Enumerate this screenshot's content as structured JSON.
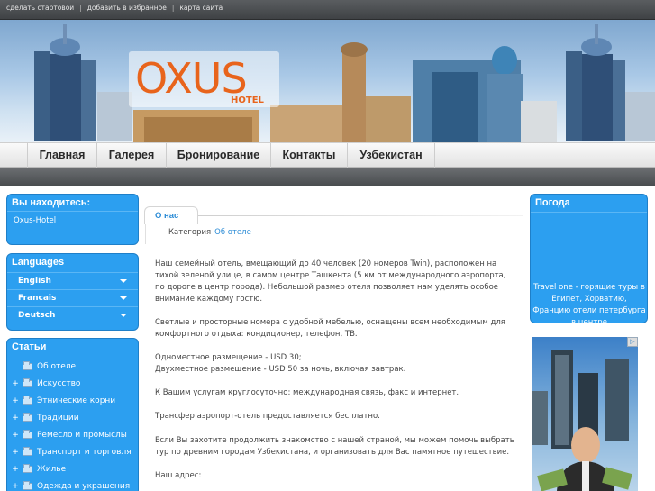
{
  "topbar": {
    "links": [
      "сделать стартовой",
      "добавить в избранное",
      "карта сайта"
    ],
    "separator": "|"
  },
  "logo": {
    "main": "OXUS",
    "sub": "HOTEL"
  },
  "nav": [
    "Главная",
    "Галерея",
    "Бронирование",
    "Контакты",
    "Узбекистан"
  ],
  "left": {
    "location_title": "Вы находитесь:",
    "location_value": "Oxus-Hotel",
    "languages_title": "Languages",
    "languages": [
      "English",
      "Francais",
      "Deutsch"
    ],
    "articles_title": "Статьи",
    "articles": [
      "Об отеле",
      "Искусство",
      "Этнические корни",
      "Традиции",
      "Ремесло и промыслы",
      "Транспорт и торговля",
      "Жилье",
      "Одежда и украшения"
    ]
  },
  "main": {
    "tab": "О нас",
    "category_label": "Категория",
    "category_link": "Об отеле",
    "paragraphs": [
      "Наш семейный отель, вмещающий до 40 человек (20 номеров Twin), расположен на тихой зеленой улице, в самом центре Ташкента (5 км от международного аэропорта, по дороге в центр города). Небольшой размер отеля позволяет нам уделять особое внимание каждому гостю.",
      "Светлые и просторные номера с удобной мебелью, оснащены всем необходимым для комфортного отдыха: кондиционер, телефон, ТВ.",
      "Одноместное размещение - USD 30;",
      "Двухместное размещение - USD 50 за ночь, включая завтрак.",
      "К Вашим услугам круглосуточно: международная связь, факс и интернет.",
      "Трансфер аэропорт-отель предоставляется бесплатно.",
      "Если Вы захотите продолжить знакомство с нашей страной, мы можем помочь выбрать тур по древним городам Узбекистана, и организовать для Вас памятное путешествие.",
      "Наш адрес:"
    ]
  },
  "right": {
    "weather_title": "Погода",
    "ad_text": "Travel one - горящие туры в Египет, Хорватию, Францию отели петербурга в центре",
    "ad_badge": "▷"
  },
  "colors": {
    "accent": "#2c9ff0",
    "logo": "#e8641c",
    "link": "#2c8cd6"
  }
}
